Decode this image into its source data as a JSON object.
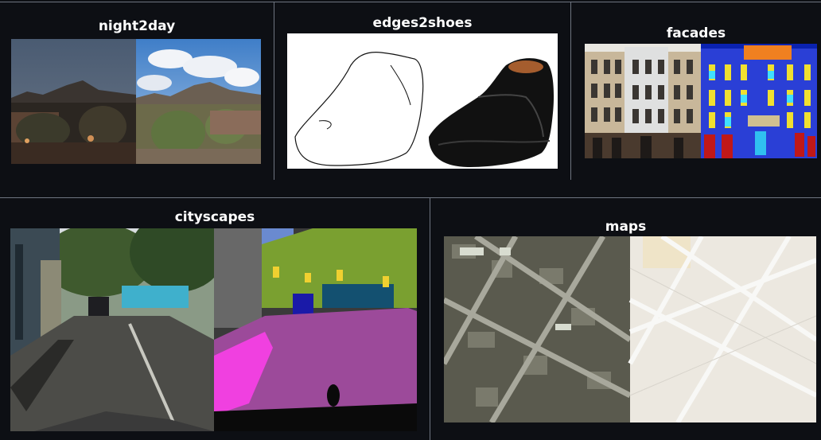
{
  "panels": {
    "night2day": {
      "title": "night2day"
    },
    "edges2shoes": {
      "title": "edges2shoes"
    },
    "facades": {
      "title": "facades"
    },
    "cityscapes": {
      "title": "cityscapes"
    },
    "maps": {
      "title": "maps"
    }
  },
  "colors": {
    "background": "#0d0f14",
    "divider": "#6e7480",
    "title_text": "#ffffff"
  }
}
